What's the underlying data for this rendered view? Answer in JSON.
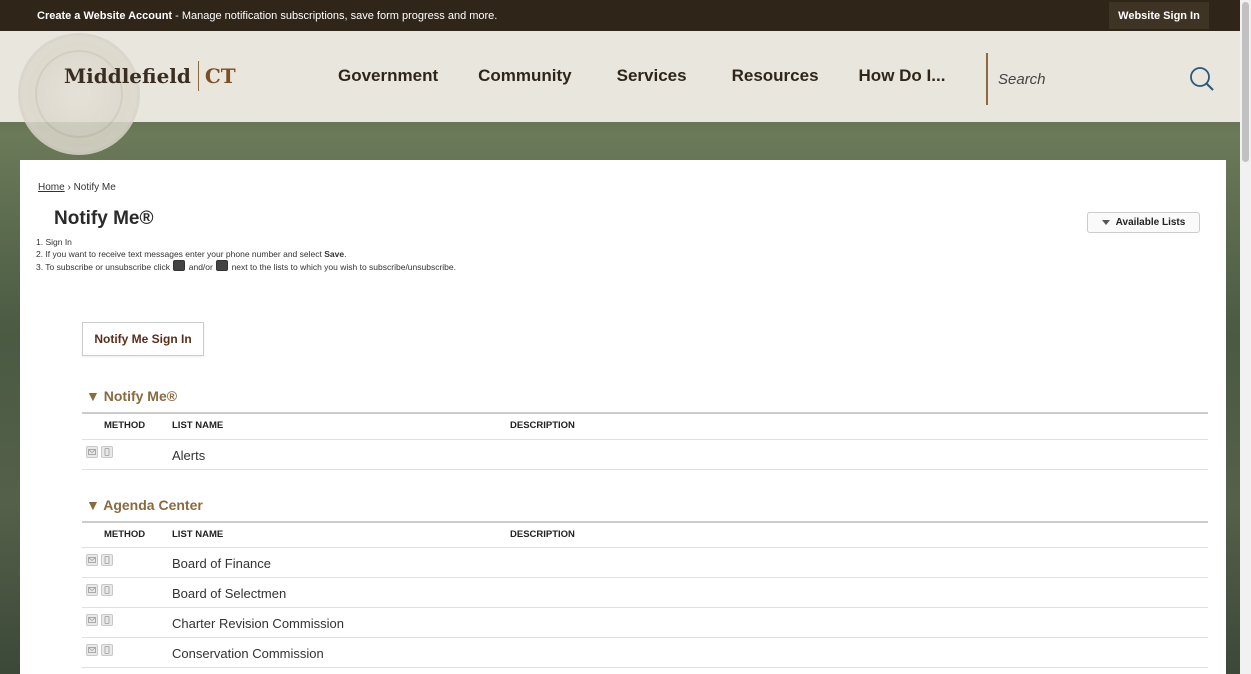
{
  "topbar": {
    "account_bold": "Create a Website Account",
    "account_rest": " - Manage notification subscriptions, save form progress and more.",
    "signin": "Website Sign In"
  },
  "header": {
    "logo_name": "Middlefield",
    "logo_ct": "CT",
    "nav": [
      "Government",
      "Community",
      "Services",
      "Resources",
      "How Do I..."
    ],
    "search_placeholder": "Search"
  },
  "breadcrumb": {
    "home": "Home",
    "sep": " › ",
    "current": "Notify Me"
  },
  "page": {
    "title": "Notify Me®",
    "available_lists": "Available Lists",
    "steps": {
      "s1": "1. Sign In",
      "s2_pre": "2. If you want to receive text messages enter your phone number and select ",
      "s2_bold": "Save",
      "s2_post": ".",
      "s3_pre": "3. To subscribe or unsubscribe click ",
      "s3_mid": " and/or ",
      "s3_post": " next to the lists to which you wish to subscribe/unsubscribe."
    },
    "signin_button": "Notify Me Sign In"
  },
  "table_headers": {
    "method": "METHOD",
    "list_name": "LIST NAME",
    "description": "DESCRIPTION"
  },
  "sections": [
    {
      "title": "▼ Notify Me®",
      "rows": [
        "Alerts"
      ]
    },
    {
      "title": "▼ Agenda Center",
      "rows": [
        "Board of Finance",
        "Board of Selectmen",
        "Charter Revision Commission",
        "Conservation Commission"
      ]
    }
  ],
  "icons": {
    "email": "email-icon",
    "phone": "phone-icon",
    "search": "search-icon"
  },
  "colors": {
    "topbar": "#2f2619",
    "accent": "#8a6a3e",
    "button_text": "#5a2e1a"
  }
}
